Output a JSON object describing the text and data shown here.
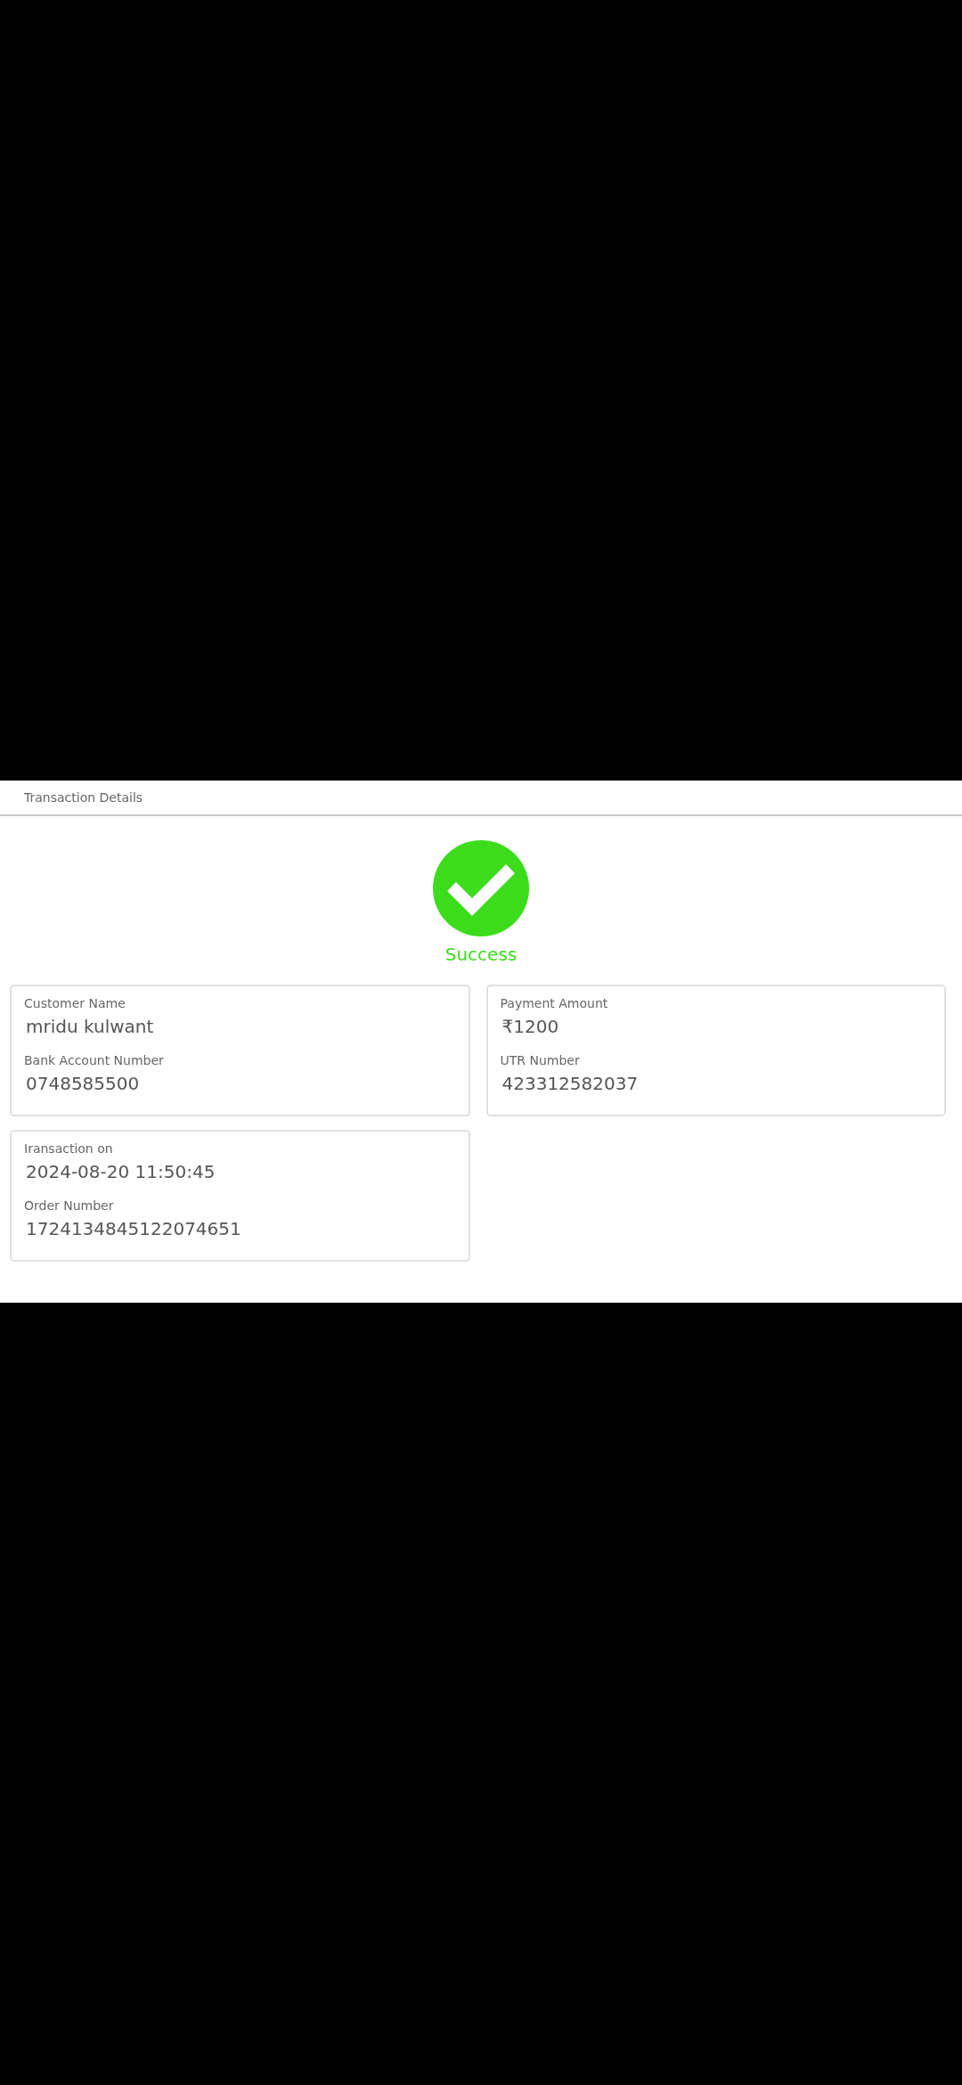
{
  "header": {
    "title": "Transaction Details"
  },
  "status": {
    "kind": "success",
    "label": "Success"
  },
  "cards": [
    {
      "fields": [
        {
          "label": "Customer Name",
          "value": "mridu kulwant"
        },
        {
          "label": "Bank Account Number",
          "value": "0748585500"
        }
      ]
    },
    {
      "fields": [
        {
          "label": "Payment Amount",
          "value": "₹1200"
        },
        {
          "label": "UTR Number",
          "value": "423312582037"
        }
      ]
    },
    {
      "fields": [
        {
          "label": "Iransaction on",
          "value": "2024-08-20 11:50:45"
        },
        {
          "label": "Order Number",
          "value": "1724134845122074651"
        }
      ]
    }
  ]
}
